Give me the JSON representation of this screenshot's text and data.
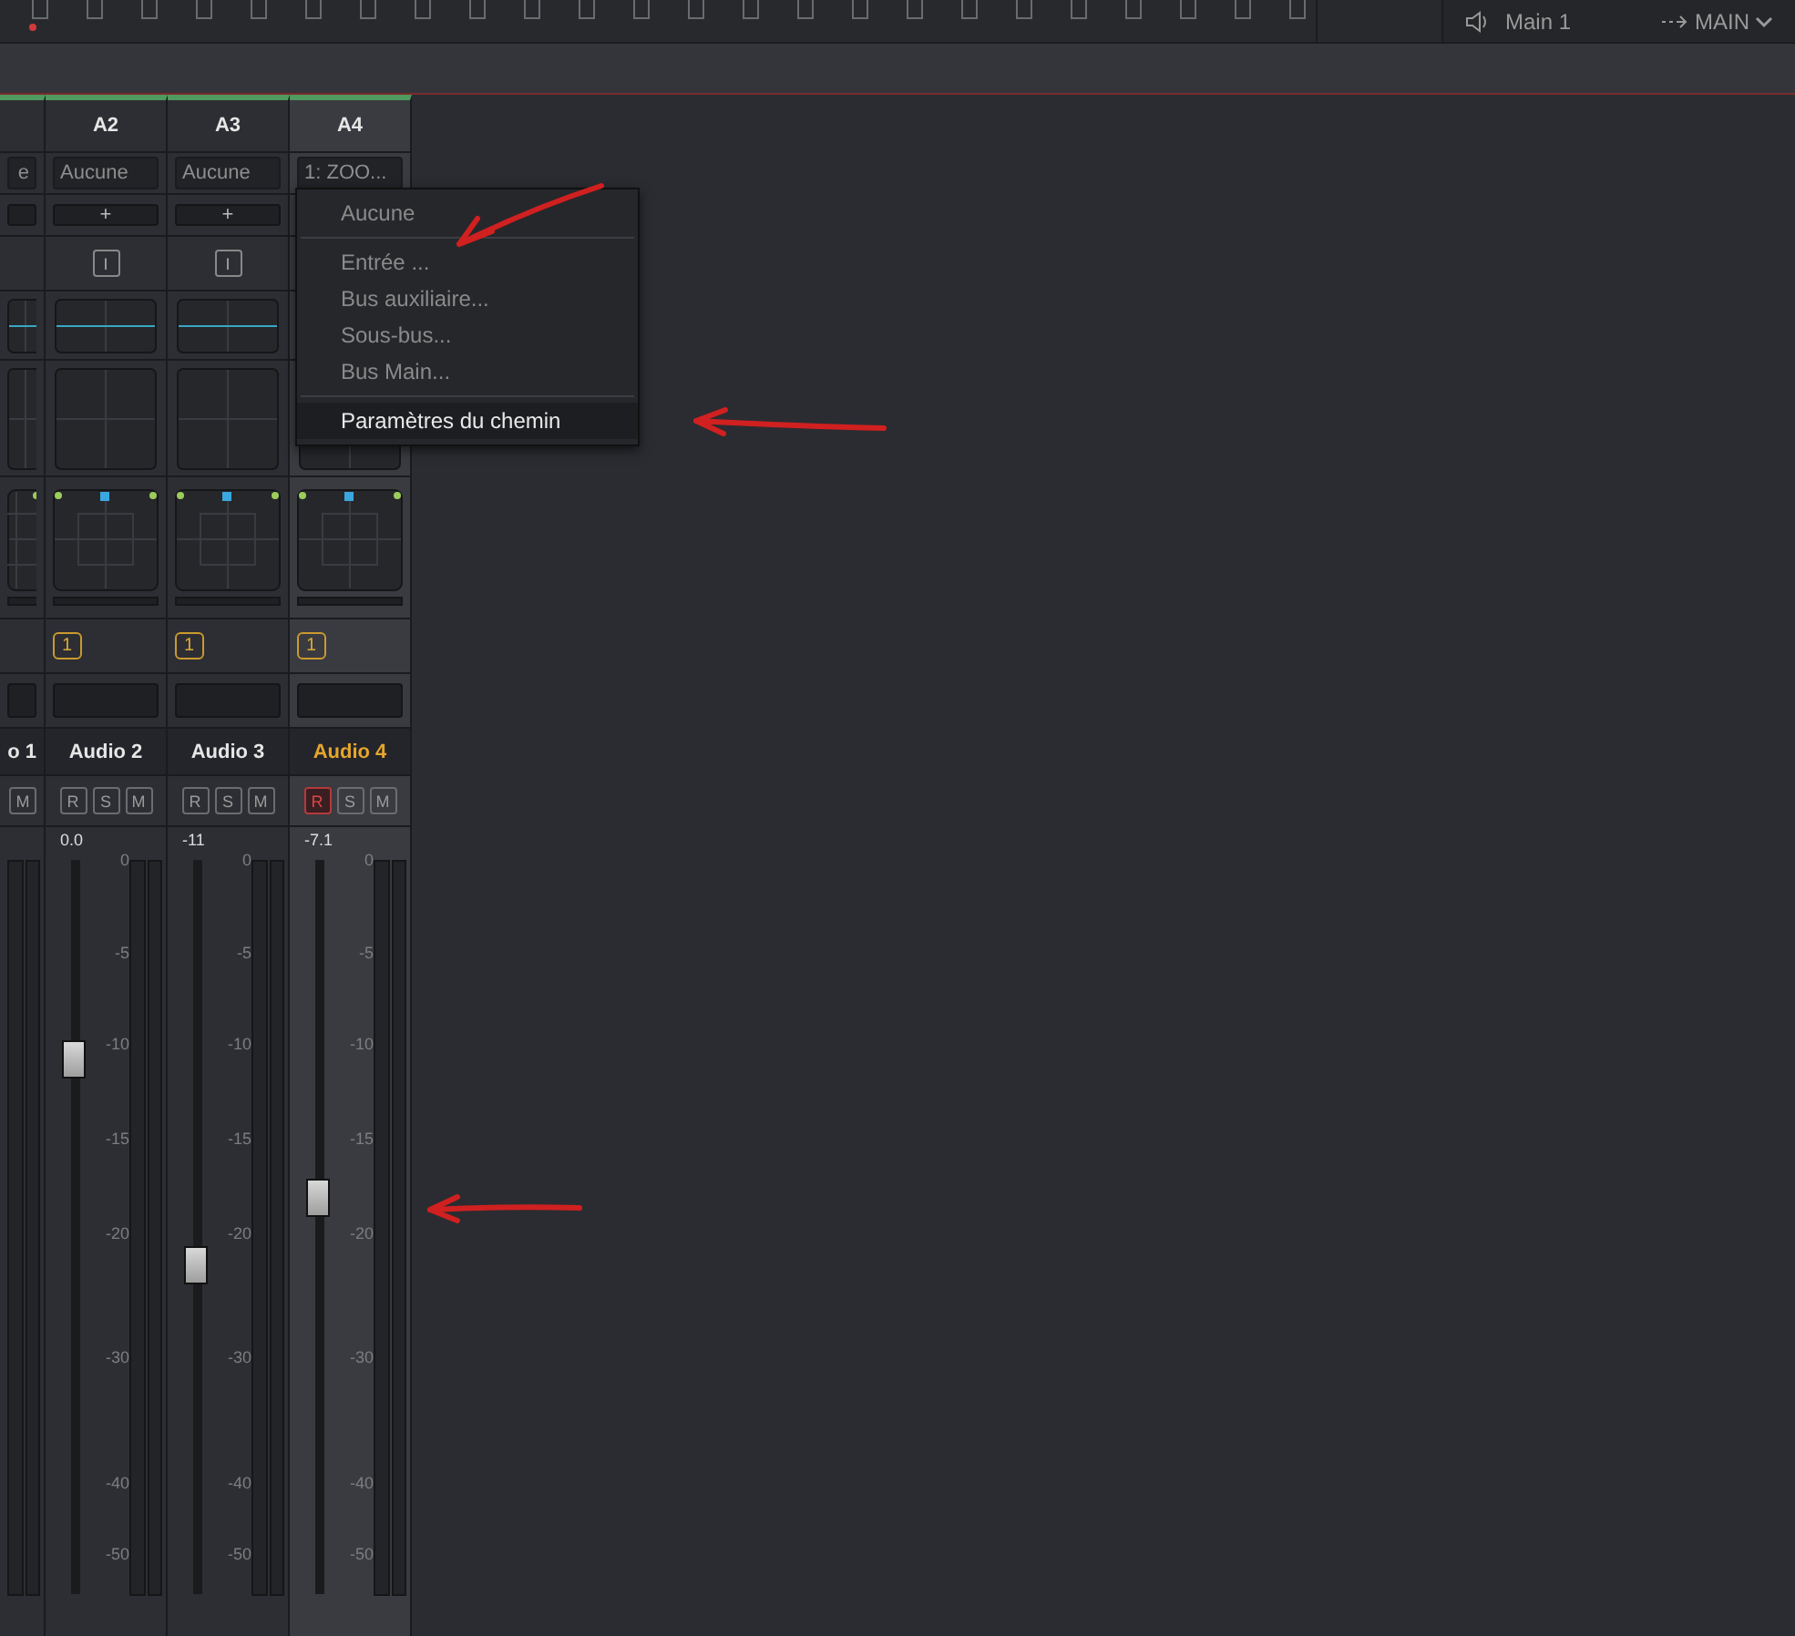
{
  "top_bar": {
    "monitor": {
      "label": "Main 1"
    },
    "output": {
      "label": "MAIN"
    }
  },
  "channels": [
    {
      "kind": "partial",
      "selected": false,
      "input": "e",
      "name": "o 1",
      "buttons": [
        {
          "label": "M",
          "on": false
        }
      ]
    },
    {
      "kind": "full",
      "selected": false,
      "track": "A2",
      "input": "Aucune",
      "add": "+",
      "insert": "I",
      "badge": "1",
      "name": "Audio 2",
      "buttons": [
        {
          "label": "R",
          "on": false
        },
        {
          "label": "S",
          "on": false
        },
        {
          "label": "M",
          "on": false
        }
      ],
      "value": "0.0",
      "level": 0.73,
      "scale": [
        "0",
        "-5",
        "-10",
        "-15",
        "-20",
        "-30",
        "-40",
        "-50"
      ]
    },
    {
      "kind": "full",
      "selected": false,
      "track": "A3",
      "input": "Aucune",
      "add": "+",
      "insert": "I",
      "badge": "1",
      "name": "Audio 3",
      "buttons": [
        {
          "label": "R",
          "on": false
        },
        {
          "label": "S",
          "on": false
        },
        {
          "label": "M",
          "on": false
        }
      ],
      "value": "-11",
      "level": 0.45,
      "scale": [
        "0",
        "-5",
        "-10",
        "-15",
        "-20",
        "-30",
        "-40",
        "-50"
      ]
    },
    {
      "kind": "full",
      "selected": true,
      "track": "A4",
      "input": "1: ZOO...",
      "badge": "1",
      "name": "Audio 4",
      "buttons": [
        {
          "label": "R",
          "on": true
        },
        {
          "label": "S",
          "on": false
        },
        {
          "label": "M",
          "on": false
        }
      ],
      "value": "-7.1",
      "level": 0.54,
      "scale": [
        "0",
        "-5",
        "-10",
        "-15",
        "-20",
        "-30",
        "-40",
        "-50"
      ]
    }
  ],
  "menu": {
    "items": [
      {
        "kind": "item",
        "label": "Aucune",
        "selected": false
      },
      {
        "kind": "separator"
      },
      {
        "kind": "item",
        "label": "Entrée ...",
        "selected": false
      },
      {
        "kind": "item",
        "label": "Bus auxiliaire...",
        "selected": false
      },
      {
        "kind": "item",
        "label": "Sous-bus...",
        "selected": false
      },
      {
        "kind": "item",
        "label": "Bus Main...",
        "selected": false
      },
      {
        "kind": "separator"
      },
      {
        "kind": "item",
        "label": "Paramètres du chemin",
        "selected": true
      }
    ]
  }
}
